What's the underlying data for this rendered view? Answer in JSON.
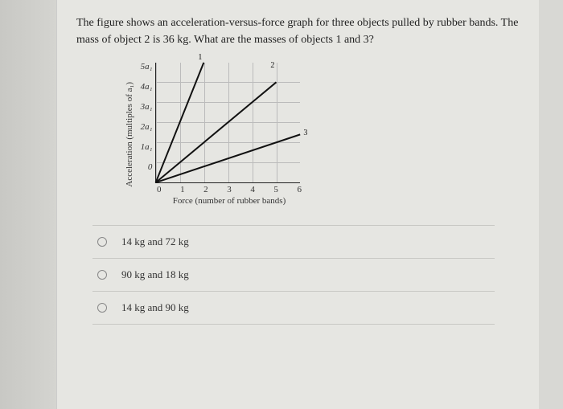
{
  "question": "The figure shows an acceleration-versus-force graph for three objects pulled by rubber bands. The mass of object 2 is 36 kg. What are the masses of objects 1 and 3?",
  "chart_data": {
    "type": "line",
    "xlabel": "Force (number of rubber bands)",
    "ylabel": "Acceleration (multiples of a₁)",
    "x": [
      0,
      1,
      2,
      3,
      4,
      5,
      6
    ],
    "yticks": [
      "5a₁",
      "4a₁",
      "3a₁",
      "2a₁",
      "1a₁",
      "0"
    ],
    "xlim": [
      0,
      6
    ],
    "ylim": [
      0,
      5
    ],
    "series": [
      {
        "name": "1",
        "points": [
          [
            0,
            0
          ],
          [
            2,
            5
          ]
        ],
        "label_pos": "top"
      },
      {
        "name": "2",
        "points": [
          [
            0,
            0
          ],
          [
            5,
            5
          ]
        ],
        "label_pos": "top-right"
      },
      {
        "name": "3",
        "points": [
          [
            0,
            0
          ],
          [
            6,
            2.4
          ]
        ],
        "label_pos": "right"
      }
    ]
  },
  "options": [
    {
      "label": "14 kg and 72 kg"
    },
    {
      "label": "90 kg and 18 kg"
    },
    {
      "label": "14 kg and 90 kg"
    }
  ]
}
